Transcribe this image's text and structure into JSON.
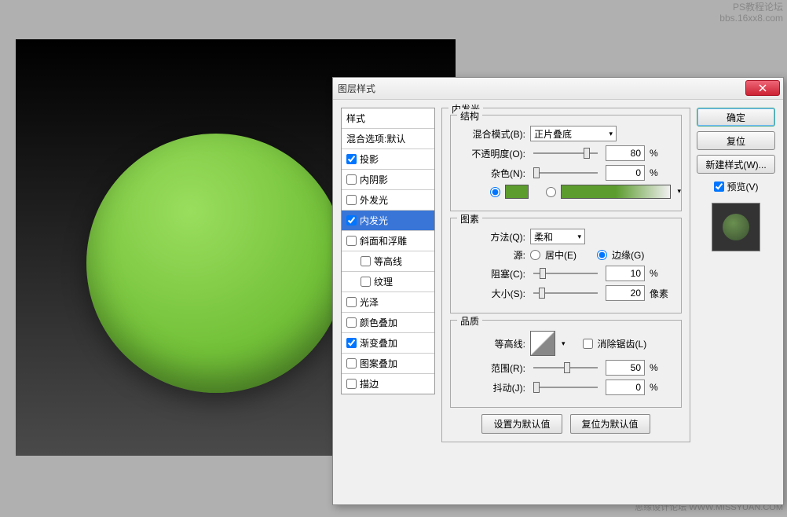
{
  "watermark": {
    "top1": "PS教程论坛",
    "top2": "bbs.16xx8.com",
    "bottom": "思缘设计论坛  WWW.MISSYUAN.COM"
  },
  "dialog": {
    "title": "图层样式"
  },
  "styles": {
    "header": "样式",
    "blend_options": "混合选项:默认",
    "drop_shadow": "投影",
    "inner_shadow": "内阴影",
    "outer_glow": "外发光",
    "inner_glow": "内发光",
    "bevel": "斜面和浮雕",
    "contour": "等高线",
    "texture": "纹理",
    "satin": "光泽",
    "color_overlay": "颜色叠加",
    "gradient_overlay": "渐变叠加",
    "pattern_overlay": "图案叠加",
    "stroke": "描边"
  },
  "panel": {
    "title": "内发光",
    "structure": "结构",
    "blend_mode_label": "混合模式(B):",
    "blend_mode_value": "正片叠底",
    "opacity_label": "不透明度(O):",
    "opacity_value": "80",
    "noise_label": "杂色(N):",
    "noise_value": "0",
    "percent": "%",
    "elements": "图素",
    "method_label": "方法(Q):",
    "method_value": "柔和",
    "source_label": "源:",
    "source_center": "居中(E)",
    "source_edge": "边缘(G)",
    "choke_label": "阻塞(C):",
    "choke_value": "10",
    "size_label": "大小(S):",
    "size_value": "20",
    "pixels": "像素",
    "quality": "品质",
    "contour_label": "等高线:",
    "antialias": "消除锯齿(L)",
    "range_label": "范围(R):",
    "range_value": "50",
    "jitter_label": "抖动(J):",
    "jitter_value": "0",
    "set_default": "设置为默认值",
    "reset_default": "复位为默认值"
  },
  "buttons": {
    "ok": "确定",
    "cancel": "复位",
    "new_style": "新建样式(W)...",
    "preview": "预览(V)"
  }
}
